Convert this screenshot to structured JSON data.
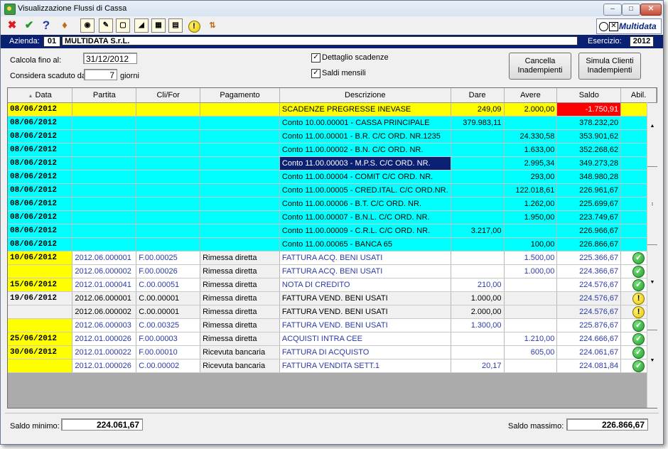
{
  "window": {
    "title": "Visualizzazione Flussi di Cassa"
  },
  "toolbar": {
    "icons": [
      "close-red-x-icon",
      "confirm-check-icon",
      "help-icon",
      "lock-icon",
      "binoculars-icon",
      "edit-icon",
      "preview-icon",
      "chart-icon",
      "grid-icon",
      "list-icon",
      "alert-icon",
      "sort-icon"
    ],
    "logo_text": "Multidata"
  },
  "azienda": {
    "label": "Azienda:",
    "code": "01",
    "name": "MULTIDATA S.r.L.",
    "esercizio_label": "Esercizio:",
    "esercizio": "2012"
  },
  "filters": {
    "calcola_label": "Calcola fino al:",
    "calcola_value": "31/12/2012",
    "scaduto_label": "Considera scaduto da",
    "scaduto_value": "7",
    "scaduto_unit": "giorni",
    "dettaglio_label": "Dettaglio scadenze",
    "saldi_label": "Saldi mensili",
    "dettaglio_checked": "✓",
    "saldi_checked": "✓"
  },
  "buttons": {
    "cancella_line1": "Cancella",
    "cancella_line2": "Inadempienti",
    "simula_line1": "Simula Clienti",
    "simula_line2": "Inadempienti"
  },
  "table": {
    "headers": {
      "data": "Data",
      "partita": "Partita",
      "clifor": "Cli/For",
      "pagamento": "Pagamento",
      "descrizione": "Descrizione",
      "dare": "Dare",
      "avere": "Avere",
      "saldo": "Saldo",
      "abil": "Abil."
    },
    "rows": [
      {
        "data": "08/06/2012",
        "partita": "",
        "clifor": "",
        "pagamento": "",
        "descrizione": "SCADENZE PREGRESSE INEVASE",
        "dare": "249,09",
        "avere": "2.000,00",
        "saldo": "-1.750,91",
        "abil": ""
      },
      {
        "data": "08/06/2012",
        "partita": "",
        "clifor": "",
        "pagamento": "",
        "descrizione": "Conto 10.00.00001 - CASSA PRINCIPALE",
        "dare": "379.983,11",
        "avere": "",
        "saldo": "378.232,20",
        "abil": ""
      },
      {
        "data": "08/06/2012",
        "partita": "",
        "clifor": "",
        "pagamento": "",
        "descrizione": "Conto 11.00.00001 - B.R. C/C ORD. NR.1235",
        "dare": "",
        "avere": "24.330,58",
        "saldo": "353.901,62",
        "abil": ""
      },
      {
        "data": "08/06/2012",
        "partita": "",
        "clifor": "",
        "pagamento": "",
        "descrizione": "Conto 11.00.00002 - B.N. C/C ORD. NR.",
        "dare": "",
        "avere": "1.633,00",
        "saldo": "352.268,62",
        "abil": ""
      },
      {
        "data": "08/06/2012",
        "partita": "",
        "clifor": "",
        "pagamento": "",
        "descrizione": "Conto 11.00.00003 - M.P.S. C/C ORD. NR.",
        "dare": "",
        "avere": "2.995,34",
        "saldo": "349.273,28",
        "abil": ""
      },
      {
        "data": "08/06/2012",
        "partita": "",
        "clifor": "",
        "pagamento": "",
        "descrizione": "Conto 11.00.00004 - COMIT C/C ORD. NR.",
        "dare": "",
        "avere": "293,00",
        "saldo": "348.980,28",
        "abil": ""
      },
      {
        "data": "08/06/2012",
        "partita": "",
        "clifor": "",
        "pagamento": "",
        "descrizione": "Conto 11.00.00005 - CRED.ITAL. C/C ORD.NR.",
        "dare": "",
        "avere": "122.018,61",
        "saldo": "226.961,67",
        "abil": ""
      },
      {
        "data": "08/06/2012",
        "partita": "",
        "clifor": "",
        "pagamento": "",
        "descrizione": "Conto 11.00.00006 - B.T. C/C ORD. NR.",
        "dare": "",
        "avere": "1.262,00",
        "saldo": "225.699,67",
        "abil": ""
      },
      {
        "data": "08/06/2012",
        "partita": "",
        "clifor": "",
        "pagamento": "",
        "descrizione": "Conto 11.00.00007 - B.N.L. C/C ORD. NR.",
        "dare": "",
        "avere": "1.950,00",
        "saldo": "223.749,67",
        "abil": ""
      },
      {
        "data": "08/06/2012",
        "partita": "",
        "clifor": "",
        "pagamento": "",
        "descrizione": "Conto 11.00.00009 - C.R.L. C/C ORD. NR.",
        "dare": "3.217,00",
        "avere": "",
        "saldo": "226.966,67",
        "abil": ""
      },
      {
        "data": "08/06/2012",
        "partita": "",
        "clifor": "",
        "pagamento": "",
        "descrizione": "Conto 11.00.00065 - BANCA 65",
        "dare": "",
        "avere": "100,00",
        "saldo": "226.866,67",
        "abil": ""
      },
      {
        "data": "10/06/2012",
        "partita": "2012.06.000001",
        "clifor": "F.00.00025",
        "pagamento": "Rimessa diretta",
        "descrizione": "FATTURA ACQ. BENI USATI",
        "dare": "",
        "avere": "1.500,00",
        "saldo": "225.366,67",
        "abil": "ok"
      },
      {
        "data": "",
        "partita": "2012.06.000002",
        "clifor": "F.00.00026",
        "pagamento": "Rimessa diretta",
        "descrizione": "FATTURA ACQ. BENI USATI",
        "dare": "",
        "avere": "1.000,00",
        "saldo": "224.366,67",
        "abil": "ok"
      },
      {
        "data": "15/06/2012",
        "partita": "2012.01.000041",
        "clifor": "C.00.00051",
        "pagamento": "Rimessa diretta",
        "descrizione": "NOTA DI CREDITO",
        "dare": "210,00",
        "avere": "",
        "saldo": "224.576,67",
        "abil": "ok"
      },
      {
        "data": "19/06/2012",
        "partita": "2012.06.000001",
        "clifor": "C.00.00001",
        "pagamento": "Rimessa diretta",
        "descrizione": "FATTURA VEND. BENI USATI",
        "dare": "1.000,00",
        "avere": "",
        "saldo": "224.576,67",
        "abil": "warn"
      },
      {
        "data": "",
        "partita": "2012.06.000002",
        "clifor": "C.00.00001",
        "pagamento": "Rimessa diretta",
        "descrizione": "FATTURA VEND. BENI USATI",
        "dare": "2.000,00",
        "avere": "",
        "saldo": "224.576,67",
        "abil": "warn"
      },
      {
        "data": "",
        "partita": "2012.06.000003",
        "clifor": "C.00.00325",
        "pagamento": "Rimessa diretta",
        "descrizione": "FATTURA VEND. BENI USATI",
        "dare": "1.300,00",
        "avere": "",
        "saldo": "225.876,67",
        "abil": "ok"
      },
      {
        "data": "25/06/2012",
        "partita": "2012.01.000026",
        "clifor": "F.00.00003",
        "pagamento": "Rimessa diretta",
        "descrizione": "ACQUISTI INTRA CEE",
        "dare": "",
        "avere": "1.210,00",
        "saldo": "224.666,67",
        "abil": "ok"
      },
      {
        "data": "30/06/2012",
        "partita": "2012.01.000022",
        "clifor": "F.00.00010",
        "pagamento": "Ricevuta bancaria",
        "descrizione": "FATTURA DI ACQUISTO",
        "dare": "",
        "avere": "605,00",
        "saldo": "224.061,67",
        "abil": "ok"
      },
      {
        "data": "",
        "partita": "2012.01.000026",
        "clifor": "C.00.00002",
        "pagamento": "Ricevuta bancaria",
        "descrizione": "FATTURA VENDITA SETT.1",
        "dare": "20,17",
        "avere": "",
        "saldo": "224.081,84",
        "abil": "ok"
      }
    ]
  },
  "footer": {
    "saldo_min_label": "Saldo minimo:",
    "saldo_min": "224.061,67",
    "saldo_max_label": "Saldo massimo:",
    "saldo_max": "226.866,67"
  },
  "colors": {
    "yellow": "#ffff00",
    "cyan": "#00ffff",
    "navy": "#0a2173",
    "red": "#ff0000"
  }
}
